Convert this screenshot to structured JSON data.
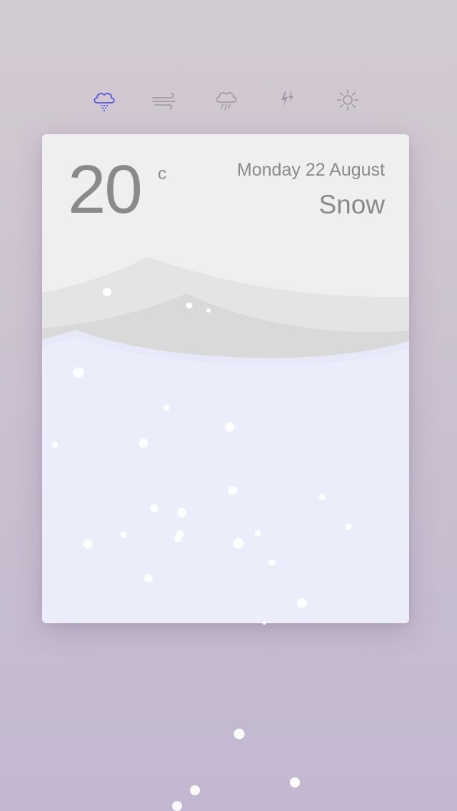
{
  "nav": {
    "items": [
      {
        "icon": "snow-cloud-icon",
        "active": true
      },
      {
        "icon": "wind-icon",
        "active": false
      },
      {
        "icon": "rain-cloud-icon",
        "active": false
      },
      {
        "icon": "thunder-icon",
        "active": false
      },
      {
        "icon": "sun-icon",
        "active": false
      }
    ],
    "active_color": "#5454e0",
    "inactive_color": "#a29ca6"
  },
  "weather": {
    "temperature": "20",
    "unit": "c",
    "date": "Monday 22 August",
    "condition": "Snow"
  },
  "colors": {
    "text": "#8a8a8a",
    "card_top": "#efefef",
    "snowflake": "#ffffff"
  }
}
